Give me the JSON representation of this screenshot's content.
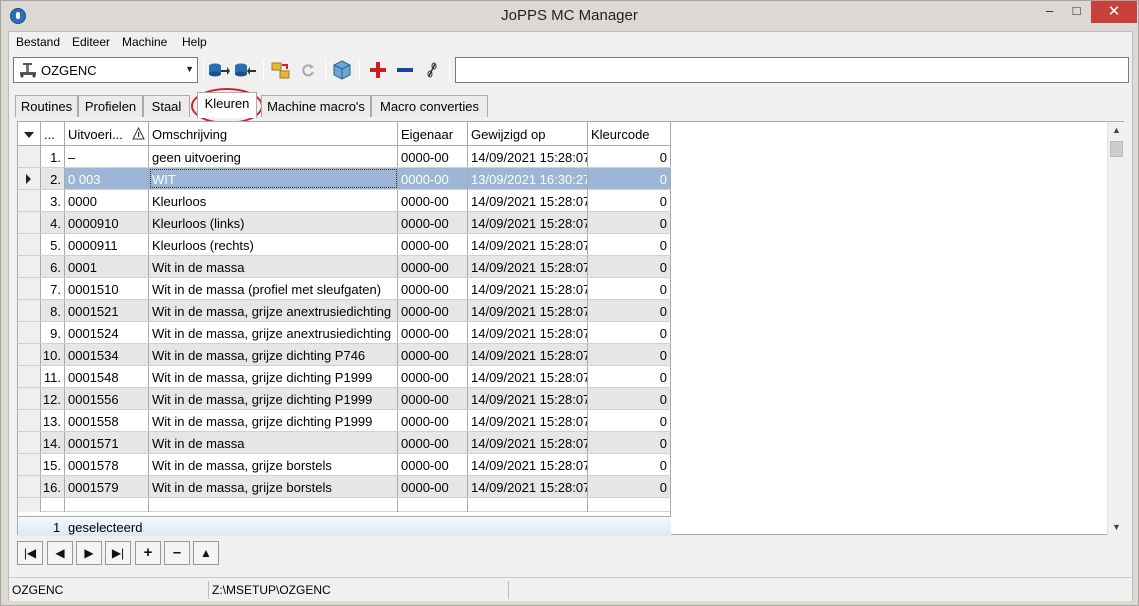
{
  "window": {
    "title": "JoPPS MC Manager",
    "minimize_glyph": "–",
    "maximize_glyph": "□",
    "close_glyph": "✕"
  },
  "menu": [
    "Bestand",
    "Editeer",
    "Machine",
    "Help"
  ],
  "toolbar": {
    "machine_value": "OZGENC",
    "search_value": ""
  },
  "tabs": [
    "Routines",
    "Profielen",
    "Staal",
    "Kleuren",
    "Machine macro's",
    "Macro converties"
  ],
  "active_tab": "Kleuren",
  "grid": {
    "columns": [
      "...",
      "Uitvoeri...",
      "Omschrijving",
      "Eigenaar",
      "Gewijzigd op",
      "Kleurcode"
    ],
    "rows": [
      {
        "n": "1.",
        "code": "–",
        "desc": "geen uitvoering",
        "owner": "0000-00",
        "date": "14/09/2021 15:28:07",
        "color": "0"
      },
      {
        "n": "2.",
        "code": "0 003",
        "desc": "WIT",
        "owner": "0000-00",
        "date": "13/09/2021 16:30:27",
        "color": "0"
      },
      {
        "n": "3.",
        "code": "0000",
        "desc": "Kleurloos",
        "owner": "0000-00",
        "date": "14/09/2021 15:28:07",
        "color": "0"
      },
      {
        "n": "4.",
        "code": "0000910",
        "desc": "Kleurloos (links)",
        "owner": "0000-00",
        "date": "14/09/2021 15:28:07",
        "color": "0"
      },
      {
        "n": "5.",
        "code": "0000911",
        "desc": "Kleurloos (rechts)",
        "owner": "0000-00",
        "date": "14/09/2021 15:28:07",
        "color": "0"
      },
      {
        "n": "6.",
        "code": "0001",
        "desc": "Wit in de massa",
        "owner": "0000-00",
        "date": "14/09/2021 15:28:07",
        "color": "0"
      },
      {
        "n": "7.",
        "code": "0001510",
        "desc": "Wit in de massa (profiel met sleufgaten)",
        "owner": "0000-00",
        "date": "14/09/2021 15:28:07",
        "color": "0"
      },
      {
        "n": "8.",
        "code": "0001521",
        "desc": "Wit in de massa, grijze anextrusiedichting",
        "owner": "0000-00",
        "date": "14/09/2021 15:28:07",
        "color": "0"
      },
      {
        "n": "9.",
        "code": "0001524",
        "desc": "Wit in de massa, grijze anextrusiedichting",
        "owner": "0000-00",
        "date": "14/09/2021 15:28:07",
        "color": "0"
      },
      {
        "n": "10.",
        "code": "0001534",
        "desc": "Wit in de massa, grijze dichting P746",
        "owner": "0000-00",
        "date": "14/09/2021 15:28:07",
        "color": "0"
      },
      {
        "n": "11.",
        "code": "0001548",
        "desc": "Wit in de massa, grijze dichting P1999",
        "owner": "0000-00",
        "date": "14/09/2021 15:28:07",
        "color": "0"
      },
      {
        "n": "12.",
        "code": "0001556",
        "desc": "Wit in de massa, grijze dichting P1999",
        "owner": "0000-00",
        "date": "14/09/2021 15:28:07",
        "color": "0"
      },
      {
        "n": "13.",
        "code": "0001558",
        "desc": "Wit in de massa, grijze dichting P1999",
        "owner": "0000-00",
        "date": "14/09/2021 15:28:07",
        "color": "0"
      },
      {
        "n": "14.",
        "code": "0001571",
        "desc": "Wit in de massa",
        "owner": "0000-00",
        "date": "14/09/2021 15:28:07",
        "color": "0"
      },
      {
        "n": "15.",
        "code": "0001578",
        "desc": "Wit in de massa, grijze borstels",
        "owner": "0000-00",
        "date": "14/09/2021 15:28:07",
        "color": "0"
      },
      {
        "n": "16.",
        "code": "0001579",
        "desc": "Wit in de massa, grijze borstels",
        "owner": "0000-00",
        "date": "14/09/2021 15:28:07",
        "color": "0"
      }
    ],
    "selected_row": 1,
    "footer_count": "1",
    "footer_label": "geselecteerd"
  },
  "nav_buttons": [
    "first",
    "prev",
    "next",
    "last",
    "add",
    "remove",
    "up"
  ],
  "status": {
    "machine": "OZGENC",
    "path": "Z:\\MSETUP\\OZGENC"
  },
  "colors": {
    "selected_row": "#9db5d6",
    "tab_highlight": "#c8262a",
    "close_button": "#c7403a"
  }
}
